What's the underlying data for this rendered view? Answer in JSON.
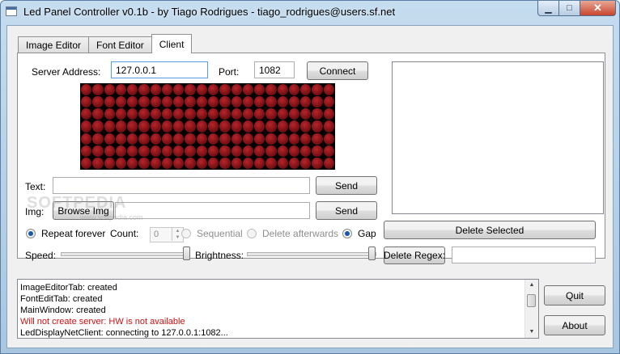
{
  "window": {
    "title": "Led Panel Controller v0.1b - by Tiago Rodrigues - tiago_rodrigues@users.sf.net"
  },
  "tabs": [
    {
      "label": "Image Editor",
      "active": false
    },
    {
      "label": "Font Editor",
      "active": false
    },
    {
      "label": "Client",
      "active": true
    }
  ],
  "client": {
    "server_label": "Server Address:",
    "server_value": "127.0.0.1",
    "port_label": "Port:",
    "port_value": "1082",
    "connect_label": "Connect",
    "led_panel": {
      "columns": 22,
      "rows": 7,
      "led_color": "#8b1a1f"
    },
    "text_label": "Text:",
    "text_value": "",
    "send_text_label": "Send",
    "img_label": "Img:",
    "browse_label": "Browse Img",
    "img_value": "",
    "send_img_label": "Send",
    "repeat_forever_label": "Repeat forever",
    "count_label": "Count:",
    "count_value": "0",
    "sequential_label": "Sequential",
    "delete_afterwards_label": "Delete afterwards",
    "gap_label": "Gap",
    "speed_label": "Speed:",
    "brightness_label": "Brightness:",
    "speed_level": 1.0,
    "brightness_level": 1.0,
    "delete_selected_label": "Delete Selected",
    "delete_regex_label": "Delete Regex:",
    "regex_value": ""
  },
  "log": {
    "lines": [
      {
        "text": "ImageEditorTab: created",
        "color": "#000000"
      },
      {
        "text": "FontEditTab: created",
        "color": "#000000"
      },
      {
        "text": "MainWindow: created",
        "color": "#000000"
      },
      {
        "text": "Will not create server: HW is not available",
        "color": "#d01010"
      },
      {
        "text": "LedDisplayNetClient: connecting to 127.0.0.1:1082...",
        "color": "#000000"
      }
    ]
  },
  "buttons": {
    "quit_label": "Quit",
    "about_label": "About"
  },
  "watermark": {
    "text": "SOFTPEDIA",
    "subtext": "www.softpedia.com"
  },
  "colors": {
    "accent": "#1b57a8",
    "error": "#d01010",
    "titlebar": "#b9d1ea"
  }
}
